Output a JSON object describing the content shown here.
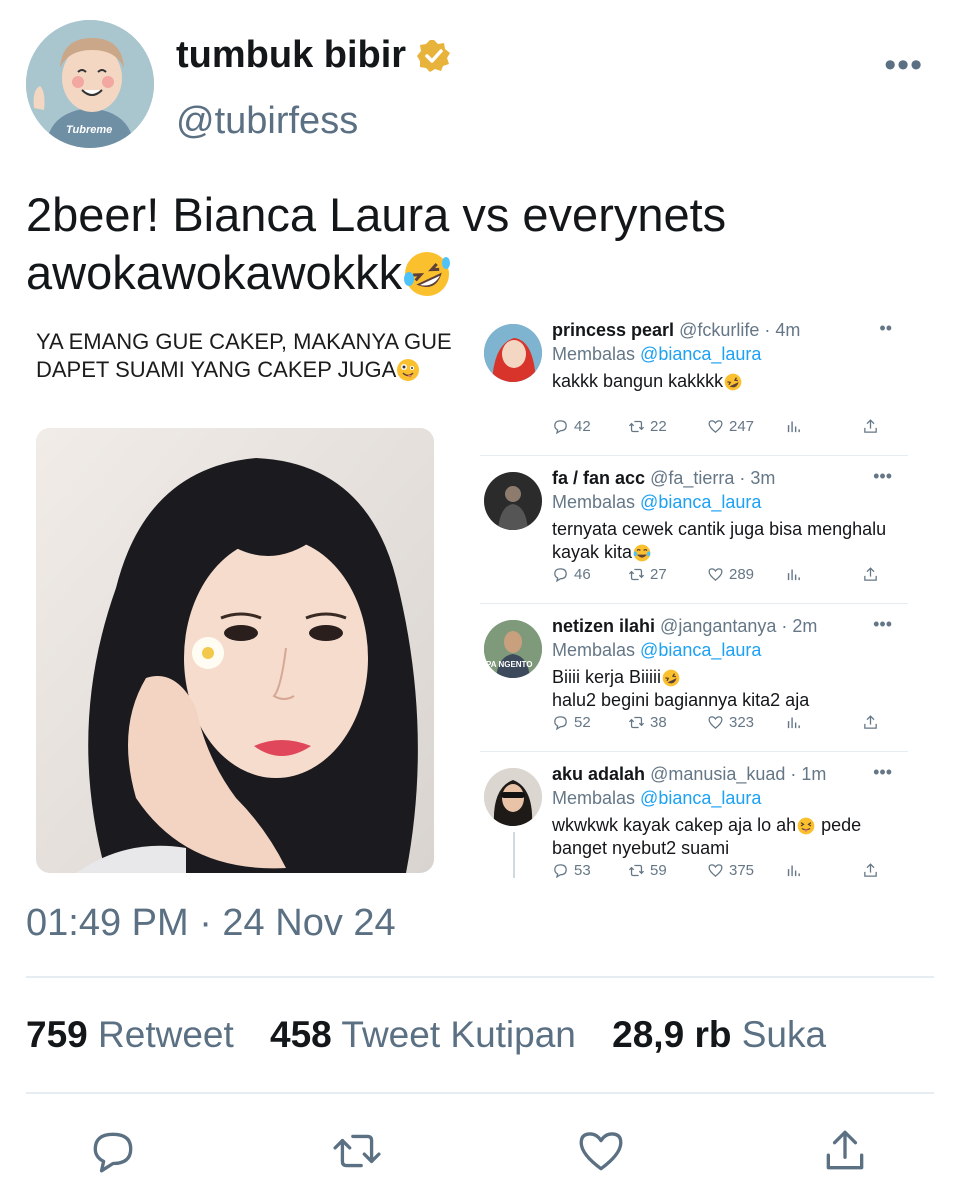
{
  "header": {
    "display_name": "tumbuk bibir",
    "handle": "@tubirfess",
    "avatar_text": "Tubreme"
  },
  "tweet": {
    "text": "2beer! Bianca Laura vs everynets awokawokawokkk"
  },
  "media": {
    "caption": "YA EMANG GUE CAKEP, MAKANYA GUE DAPET SUAMI YANG CAKEP JUGA"
  },
  "replies": [
    {
      "name": "princess pearl",
      "meta": "@fckurlife · 4m",
      "reply_label": "Membalas",
      "reply_to": "@bianca_laura",
      "body": "kakkk bangun kakkkk",
      "replies": "42",
      "retweets": "22",
      "likes": "247"
    },
    {
      "name": "fa / fan acc",
      "meta": "@fa_tierra · 3m",
      "reply_label": "Membalas",
      "reply_to": "@bianca_laura",
      "body": "ternyata cewek cantik juga bisa menghalu kayak kita",
      "replies": "46",
      "retweets": "27",
      "likes": "289"
    },
    {
      "name": "netizen ilahi",
      "meta": "@jangantanya · 2m",
      "reply_label": "Membalas",
      "reply_to": "@bianca_laura",
      "body_line1": "Biiii kerja Biiiii",
      "body_line2": "halu2 begini bagiannya kita2 aja",
      "replies": "52",
      "retweets": "38",
      "likes": "323",
      "avatar_text": "PA NGENTO"
    },
    {
      "name": "aku adalah",
      "meta": "@manusia_kuad · 1m",
      "reply_label": "Membalas",
      "reply_to": "@bianca_laura",
      "body_part1": "wkwkwk kayak cakep aja lo ah",
      "body_part2": "pede banget nyebut2 suami",
      "replies": "53",
      "retweets": "59",
      "likes": "375"
    }
  ],
  "footer": {
    "timestamp": "01:49 PM · 24 Nov 24",
    "retweets_count": "759",
    "retweets_label": "Retweet",
    "quotes_count": "458",
    "quotes_label": "Tweet Kutipan",
    "likes_count": "28,9 rb",
    "likes_label": "Suka"
  },
  "colors": {
    "link": "#1da1f2",
    "secondary_text": "#5b7083",
    "verified": "#e8b33b"
  }
}
